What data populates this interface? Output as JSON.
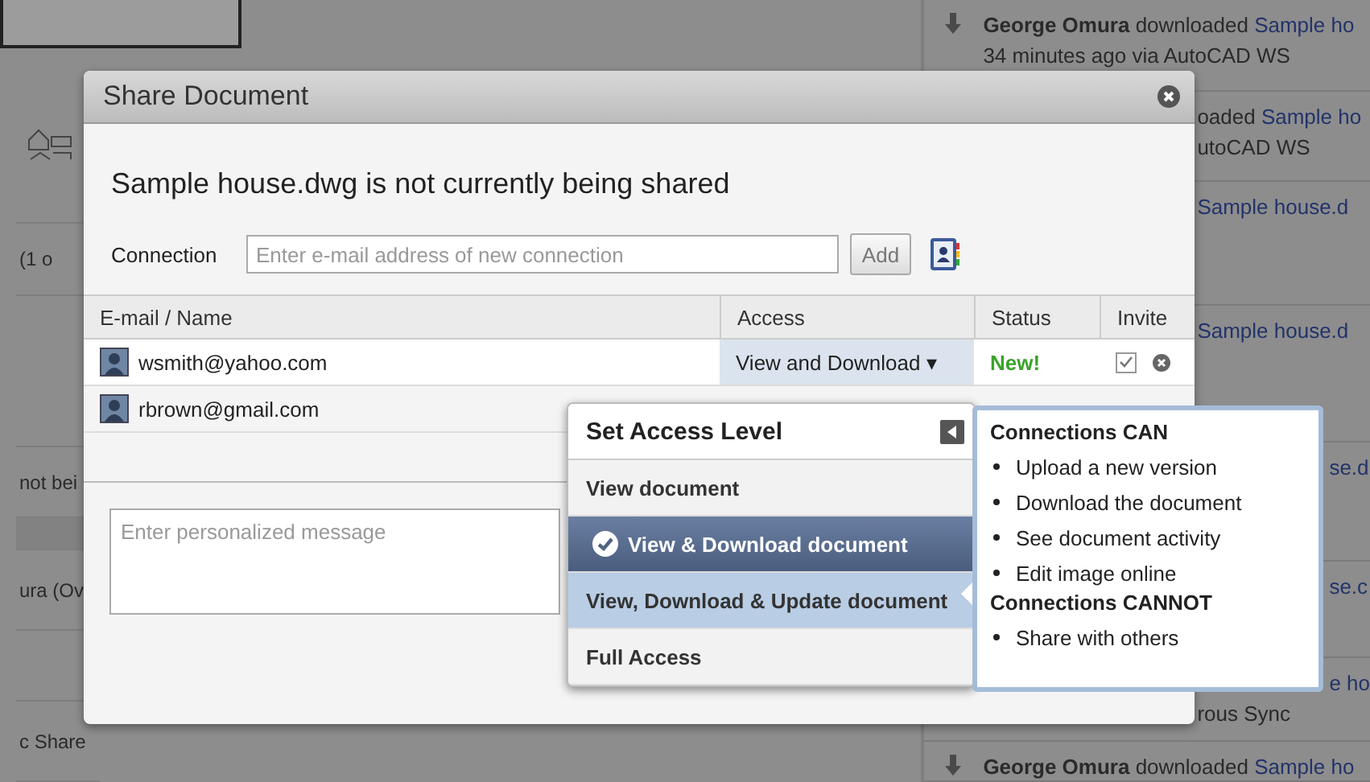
{
  "background": {
    "left_fragments": [
      {
        "kind": "thumbnail"
      },
      {
        "kind": "text",
        "text": "(1 o"
      },
      {
        "kind": "blank"
      },
      {
        "kind": "text",
        "text": "not bei"
      },
      {
        "kind": "band"
      },
      {
        "kind": "text",
        "text": "ura (Ov"
      },
      {
        "kind": "blank"
      },
      {
        "kind": "text",
        "text": "c Share"
      }
    ],
    "feed": [
      {
        "kind": "download",
        "actor": "George Omura",
        "action": "downloaded",
        "link": "Sample ho",
        "detail": "34 minutes ago via AutoCAD WS"
      },
      {
        "kind": "fragment",
        "action": "oaded",
        "link": "Sample ho",
        "detail": "utoCAD WS"
      },
      {
        "kind": "fragment",
        "link": "Sample house.d"
      },
      {
        "kind": "fragment",
        "link": "Sample house.d"
      },
      {
        "kind": "fragment",
        "link": "se.d"
      },
      {
        "kind": "fragment",
        "link": "se.c"
      },
      {
        "kind": "fragment",
        "link": "e ho",
        "detail": "rous Sync"
      },
      {
        "kind": "download",
        "actor": "George Omura",
        "action": "downloaded",
        "link": "Sample ho"
      }
    ]
  },
  "dialog": {
    "title": "Share Document",
    "heading": "Sample house.dwg is not currently being shared",
    "connection_label": "Connection",
    "connection_placeholder": "Enter e-mail address of new connection",
    "add_button": "Add",
    "columns": [
      "E-mail / Name",
      "Access",
      "Status",
      "Invite"
    ],
    "rows": [
      {
        "email": "wsmith@yahoo.com",
        "access": "View and Download ▾",
        "status": "New!",
        "invite": {
          "checked": true
        }
      },
      {
        "email": "rbrown@gmail.com"
      }
    ],
    "message_placeholder": "Enter personalized message"
  },
  "dropdown": {
    "title": "Set Access Level",
    "options": [
      {
        "label": "View document",
        "selected": false,
        "highlighted": false
      },
      {
        "label": "View & Download document",
        "selected": true,
        "highlighted": false
      },
      {
        "label": "View, Download & Update document",
        "selected": false,
        "highlighted": true
      },
      {
        "label": "Full Access",
        "selected": false,
        "highlighted": false
      }
    ]
  },
  "info": {
    "sections": [
      {
        "title": "Connections CAN",
        "items": [
          "Upload a new version",
          "Download the document",
          "See document activity",
          "Edit image online"
        ]
      },
      {
        "title": "Connections CANNOT",
        "items": [
          "Share with others"
        ]
      }
    ]
  }
}
